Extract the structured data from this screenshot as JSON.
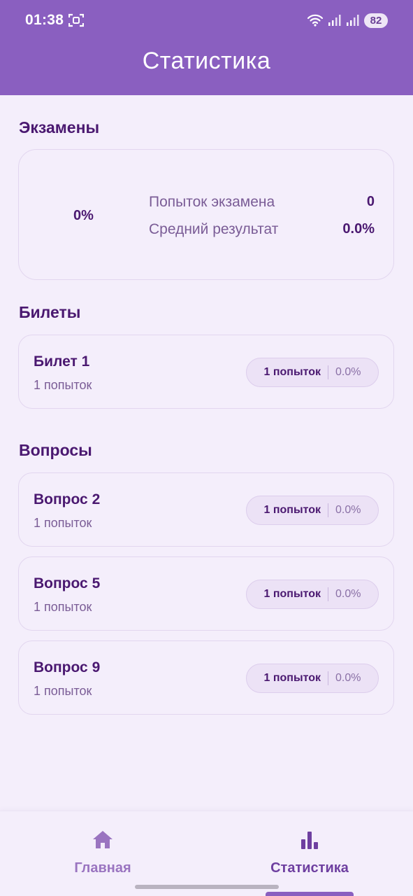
{
  "status_bar": {
    "time": "01:38",
    "battery": "82"
  },
  "header": {
    "title": "Статистика"
  },
  "exams": {
    "section_title": "Экзамены",
    "percent": "0%",
    "attempts_label": "Попыток экзамена",
    "attempts_value": "0",
    "average_label": "Средний результат",
    "average_value": "0.0%"
  },
  "tickets": {
    "section_title": "Билеты",
    "items": [
      {
        "title": "Билет 1",
        "subtitle": "1 попыток",
        "pill_attempts": "1 попыток",
        "pill_percent": "0.0%"
      }
    ]
  },
  "questions": {
    "section_title": "Вопросы",
    "items": [
      {
        "title": "Вопрос 2",
        "subtitle": "1 попыток",
        "pill_attempts": "1 попыток",
        "pill_percent": "0.0%"
      },
      {
        "title": "Вопрос 5",
        "subtitle": "1 попыток",
        "pill_attempts": "1 попыток",
        "pill_percent": "0.0%"
      },
      {
        "title": "Вопрос 9",
        "subtitle": "1 попыток",
        "pill_attempts": "1 попыток",
        "pill_percent": "0.0%"
      }
    ]
  },
  "bottom_nav": {
    "home_label": "Главная",
    "home_icon": "home-icon",
    "stats_label": "Статистика",
    "stats_icon": "bar-chart-icon",
    "active": "Статистика"
  },
  "colors": {
    "primary": "#8a5fc0",
    "background": "#f4eefb",
    "text_dark": "#4a1870",
    "text_muted": "#7a5c96"
  }
}
